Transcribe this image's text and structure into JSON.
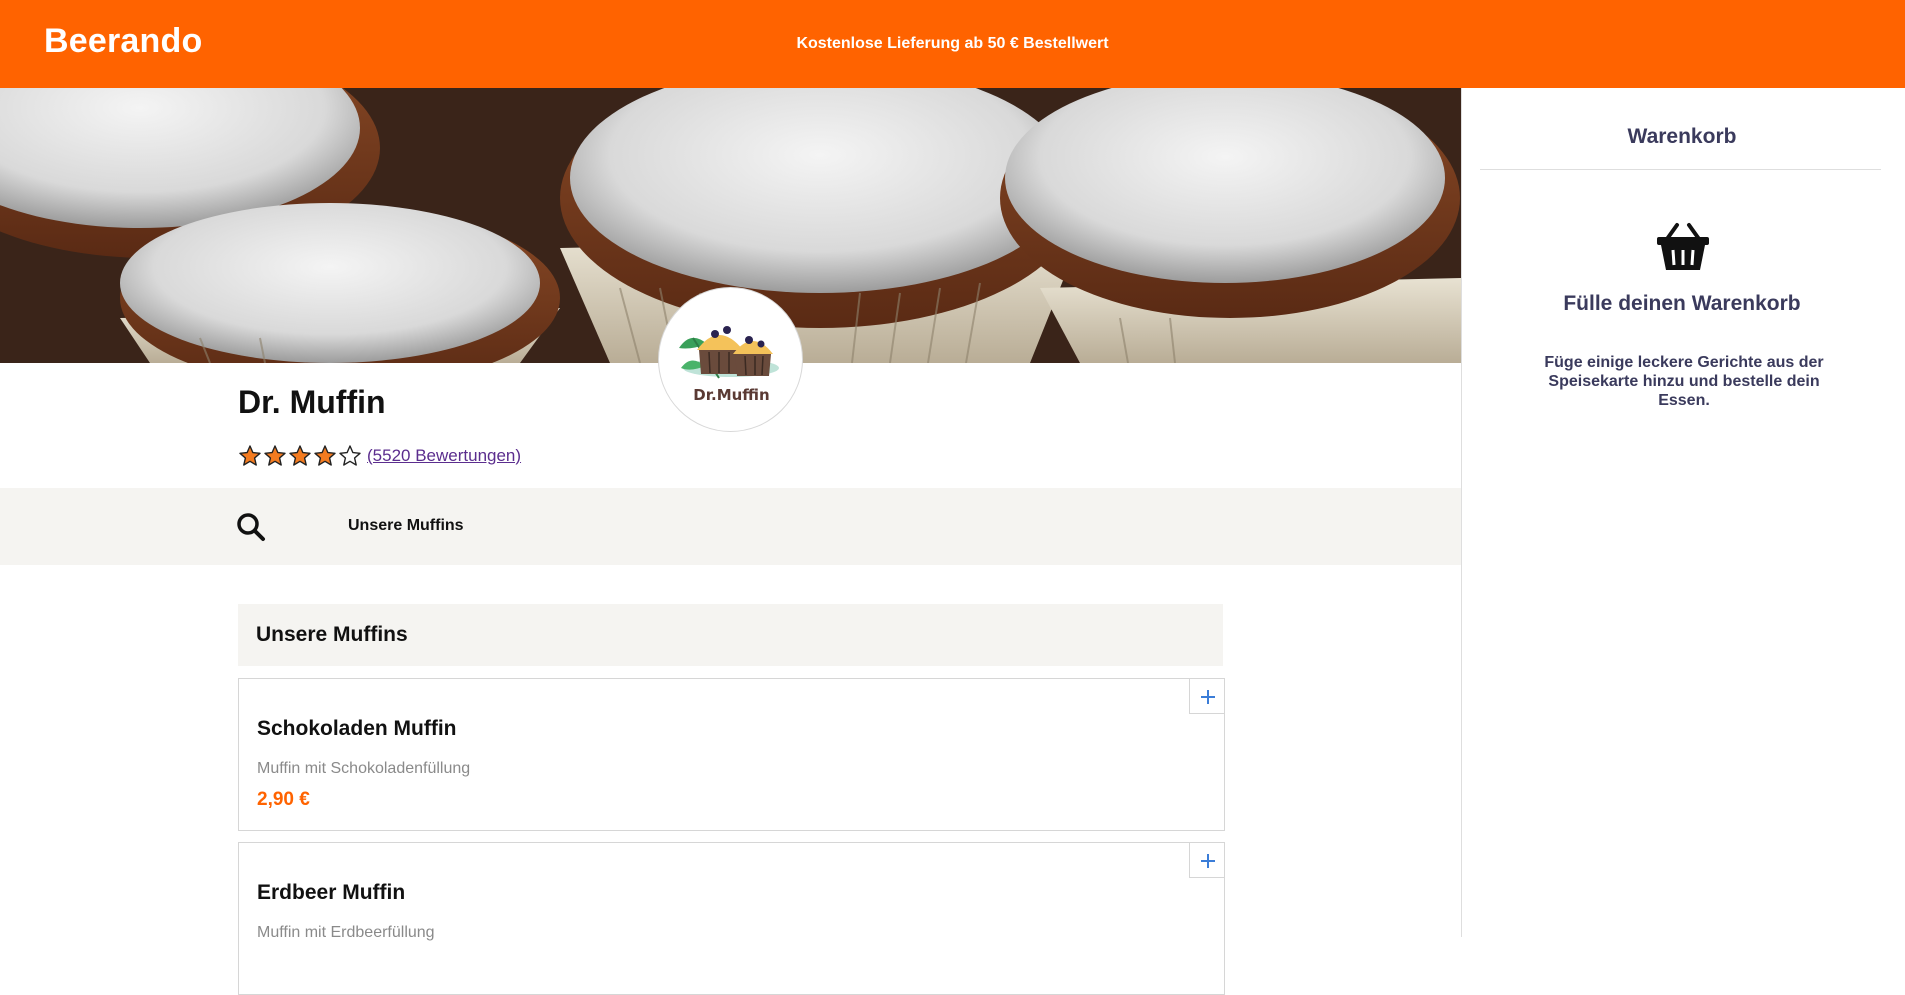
{
  "header": {
    "brand": "Beerando",
    "promo": "Kostenlose Lieferung ab 50 € Bestellwert"
  },
  "shop": {
    "name": "Dr. Muffin",
    "logo_text": "Dr.Muffin",
    "rating": 4,
    "rating_max": 5,
    "reviews_label": "(5520 Bewertungen)"
  },
  "categories": {
    "items": [
      "Unsere Muffins"
    ]
  },
  "menu": {
    "section_title": "Unsere Muffins",
    "products": [
      {
        "name": "Schokoladen Muffin",
        "description": "Muffin mit Schokoladenfüllung",
        "price": "2,90 €"
      },
      {
        "name": "Erdbeer Muffin",
        "description": "Muffin mit Erdbeerfüllung",
        "price": ""
      }
    ]
  },
  "cart": {
    "title": "Warenkorb",
    "empty_title": "Fülle deinen Warenkorb",
    "empty_text": "Füge einige leckere Gerichte aus der Speisekarte hinzu und bestelle dein Essen."
  },
  "colors": {
    "brand": "#ff6300",
    "star": "#f47b20",
    "cart_text": "#3a3a5c",
    "add_icon": "#3b7dd8"
  },
  "icons": {
    "search": "search-icon",
    "add": "plus-icon",
    "basket": "basket-icon",
    "star_full": "star-filled-icon",
    "star_empty": "star-outline-icon"
  }
}
